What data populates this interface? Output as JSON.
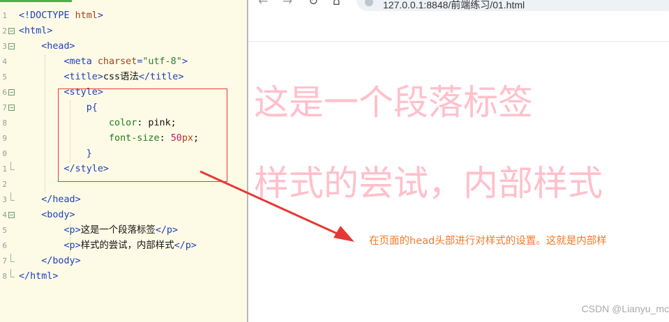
{
  "editor": {
    "lines": [
      {
        "n": "1",
        "fold": "",
        "parts": [
          [
            "tag",
            "<!DOCTYPE "
          ],
          [
            "attr",
            "html"
          ],
          [
            "tag",
            ">"
          ]
        ]
      },
      {
        "n": "2",
        "fold": "open",
        "parts": [
          [
            "tag",
            "<html>"
          ]
        ]
      },
      {
        "n": "3",
        "fold": "open",
        "parts": [
          [
            "txt",
            "    "
          ],
          [
            "tag",
            "<head>"
          ]
        ]
      },
      {
        "n": "4",
        "fold": "",
        "parts": [
          [
            "txt",
            "        "
          ],
          [
            "tag",
            "<meta "
          ],
          [
            "attr",
            "charset"
          ],
          [
            "tag",
            "="
          ],
          [
            "str",
            "\"utf-8\""
          ],
          [
            "tag",
            ">"
          ]
        ]
      },
      {
        "n": "5",
        "fold": "",
        "parts": [
          [
            "txt",
            "        "
          ],
          [
            "tag",
            "<title>"
          ],
          [
            "txt",
            "css语法"
          ],
          [
            "tag",
            "</title>"
          ]
        ]
      },
      {
        "n": "6",
        "fold": "open",
        "parts": [
          [
            "txt",
            "        "
          ],
          [
            "tag",
            "<style>"
          ]
        ]
      },
      {
        "n": "7",
        "fold": "open",
        "parts": [
          [
            "txt",
            "            "
          ],
          [
            "tag",
            "p{"
          ]
        ]
      },
      {
        "n": "8",
        "fold": "",
        "parts": [
          [
            "txt",
            "                "
          ],
          [
            "prop",
            "color"
          ],
          [
            "txt",
            ": pink;"
          ]
        ]
      },
      {
        "n": "9",
        "fold": "",
        "parts": [
          [
            "txt",
            "                "
          ],
          [
            "prop",
            "font-size"
          ],
          [
            "txt",
            ": "
          ],
          [
            "num",
            "50"
          ],
          [
            "attr",
            "px"
          ],
          [
            "txt",
            ";"
          ]
        ]
      },
      {
        "n": "0",
        "fold": "",
        "parts": [
          [
            "txt",
            "            "
          ],
          [
            "tag",
            "}"
          ]
        ]
      },
      {
        "n": "1",
        "fold": "end",
        "parts": [
          [
            "txt",
            "        "
          ],
          [
            "tag",
            "</style>"
          ]
        ]
      },
      {
        "n": "2",
        "fold": "",
        "parts": [
          [
            "txt",
            ""
          ]
        ]
      },
      {
        "n": "3",
        "fold": "end",
        "parts": [
          [
            "txt",
            "    "
          ],
          [
            "tag",
            "</head>"
          ]
        ]
      },
      {
        "n": "4",
        "fold": "open",
        "parts": [
          [
            "txt",
            "    "
          ],
          [
            "tag",
            "<body>"
          ]
        ]
      },
      {
        "n": "5",
        "fold": "",
        "parts": [
          [
            "txt",
            "        "
          ],
          [
            "tag",
            "<p>"
          ],
          [
            "txt",
            "这是一个段落标签"
          ],
          [
            "tag",
            "</p>"
          ]
        ]
      },
      {
        "n": "6",
        "fold": "",
        "parts": [
          [
            "txt",
            "        "
          ],
          [
            "tag",
            "<p>"
          ],
          [
            "txt",
            "样式的尝试，内部样式"
          ],
          [
            "tag",
            "</p>"
          ]
        ]
      },
      {
        "n": "7",
        "fold": "end",
        "parts": [
          [
            "txt",
            "    "
          ],
          [
            "tag",
            "</body>"
          ]
        ]
      },
      {
        "n": "8",
        "fold": "end",
        "parts": [
          [
            "tag",
            "</html>"
          ]
        ]
      }
    ]
  },
  "browser": {
    "nav": {
      "back": "←",
      "forward": "→",
      "reload": "↻",
      "home": "⌂"
    },
    "address": "127.0.0.1:8848/前端练习/01.html",
    "paragraphs": [
      "这是一个段落标签",
      "样式的尝试，内部样式"
    ],
    "paragraph_color": "pink"
  },
  "annotation": "在页面的head头部进行对样式的设置。这就是内部样",
  "watermark": "CSDN @Lianyu_mc",
  "colors": {
    "highlight_box": "#e53935",
    "annotation": "#f07a2a",
    "editor_bg": "#fdfbe6"
  }
}
